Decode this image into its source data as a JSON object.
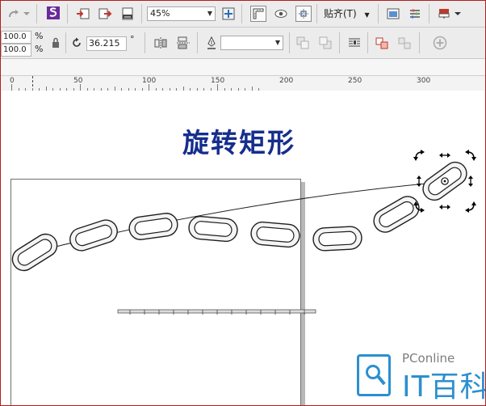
{
  "toolbar_top": {
    "zoom": {
      "value": "45%"
    },
    "snap_menu": {
      "label": "贴齐(T)"
    }
  },
  "property_bar": {
    "scale_x": "100.0",
    "scale_y": "100.0",
    "percent_unit": "%",
    "rotation_value": "36.215",
    "degree_unit": "°",
    "outline_width": ""
  },
  "ruler": {
    "labels": [
      "0",
      "50",
      "100",
      "150",
      "200",
      "250",
      "300"
    ]
  },
  "canvas": {
    "title": "旋转矩形"
  },
  "watermark": {
    "small_text": "PConline",
    "big_text": "IT百科"
  },
  "icons": {
    "redo": "redo-icon",
    "app": "corel-app-icon",
    "import": "import-icon",
    "export": "export-icon",
    "publish_pdf": "publish-pdf-icon",
    "full_screen": "full-screen-icon",
    "rulers": "rulers-icon",
    "view": "view-icon",
    "guidelines": "guidelines-icon",
    "welcome": "welcome-screen-icon",
    "options": "options-icon",
    "application_launcher": "application-launcher-icon",
    "lock_ratio": "lock-ratio-icon",
    "rotation": "rotation-icon",
    "mirror_h": "mirror-horizontal-icon",
    "mirror_v": "mirror-vertical-icon",
    "outline_pen": "outline-pen-icon",
    "to_front": "to-front-icon",
    "to_back": "to-back-icon",
    "wrap_text": "wrap-text-icon",
    "combine": "combine-icon",
    "break_apart": "break-apart-icon",
    "quick_customize": "quick-customize-icon"
  },
  "colors": {
    "title": "#162e8c",
    "toolbar_bg": "#ececec",
    "watermark_blue": "#2b8fd0",
    "frame_border": "#b01e1e"
  }
}
